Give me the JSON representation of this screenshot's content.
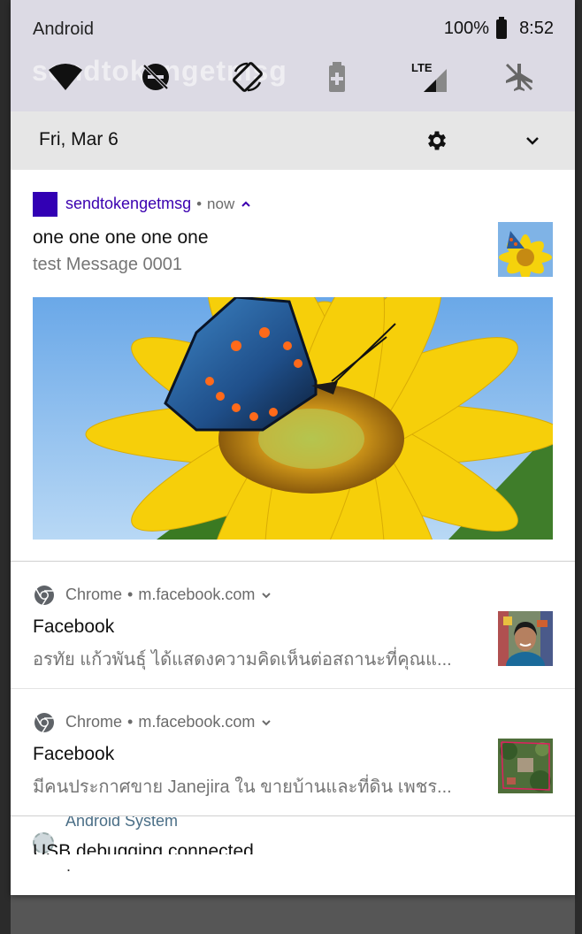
{
  "status_bar": {
    "carrier": "Android",
    "battery": "100%",
    "time": "8:52",
    "ghost_text": "sendtokengetmsg"
  },
  "quick_settings": {
    "tiles": [
      "wifi-icon",
      "do-not-disturb-off-icon",
      "auto-rotate-icon",
      "battery-saver-icon",
      "lte-signal-icon",
      "airplane-mode-off-icon"
    ],
    "lte_label": "LTE",
    "date": "Fri, Mar 6"
  },
  "notifications": [
    {
      "app": "sendtokengetmsg",
      "sep": "•",
      "time": "now",
      "title": "one one one one one",
      "text": "test Message 0001",
      "accent": "#3200b4"
    },
    {
      "app": "Chrome",
      "sep": "•",
      "site": "m.facebook.com",
      "title": "Facebook",
      "text": "อรทัย แก้วพันธุ์ ได้แสดงความคิดเห็นต่อสถานะที่คุณแ..."
    },
    {
      "app": "Chrome",
      "sep": "•",
      "site": "m.facebook.com",
      "title": "Facebook",
      "text": "มีคนประกาศขาย Janejira ใน ขายบ้านและที่ดิน เพชร..."
    },
    {
      "app": "Android System",
      "title": "USB debugging connected",
      "text": "."
    }
  ]
}
